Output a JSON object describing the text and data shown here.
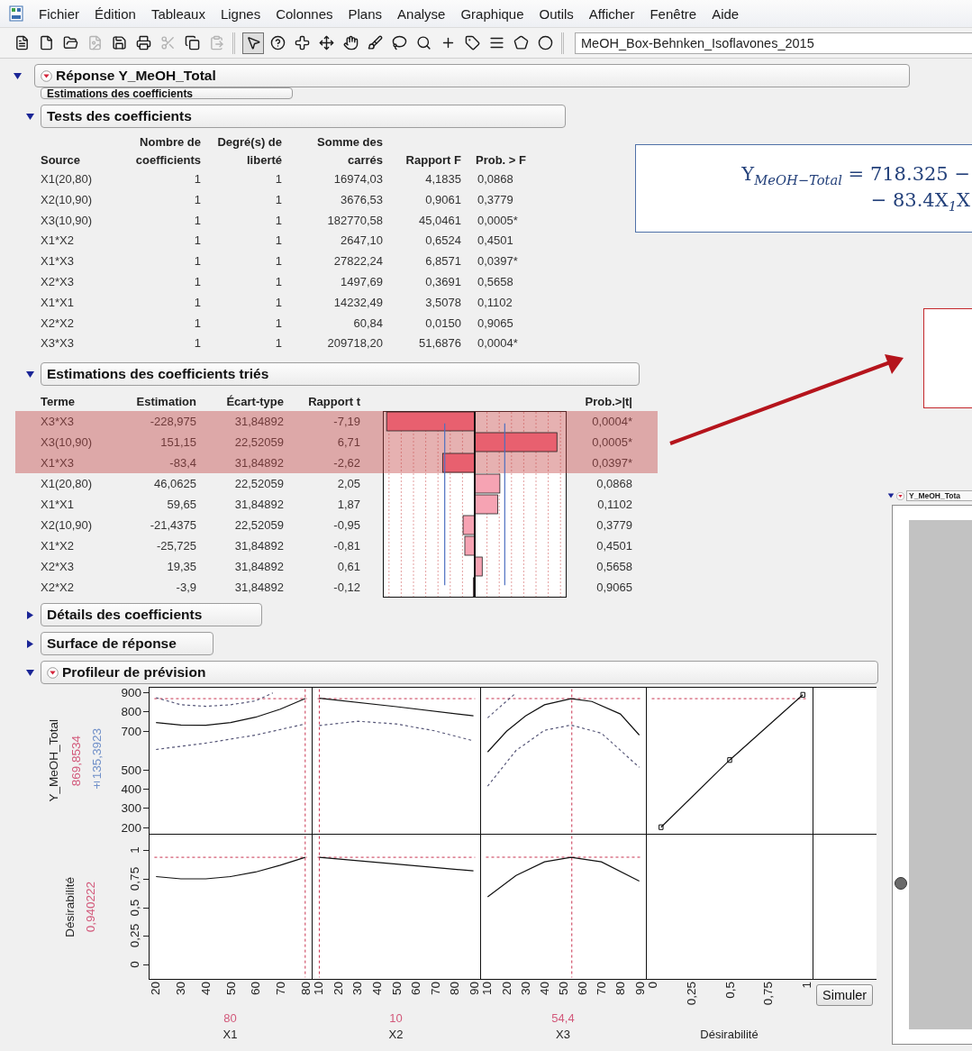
{
  "menu_bar": {
    "items": [
      "Fichier",
      "Édition",
      "Tableaux",
      "Lignes",
      "Colonnes",
      "Plans",
      "Analyse",
      "Graphique",
      "Outils",
      "Afficher",
      "Fenêtre",
      "Aide"
    ]
  },
  "toolbar": {
    "groups": [
      {
        "tools": [
          {
            "kind": "report",
            "selected": false,
            "disabled": false
          },
          {
            "kind": "new",
            "selected": false,
            "disabled": false
          },
          {
            "kind": "open",
            "selected": false,
            "disabled": false
          },
          {
            "kind": "image",
            "selected": false,
            "disabled": true
          },
          {
            "kind": "save",
            "selected": false,
            "disabled": false
          },
          {
            "kind": "print",
            "selected": false,
            "disabled": false
          },
          {
            "kind": "cut",
            "selected": false,
            "disabled": true
          },
          {
            "kind": "copy",
            "selected": false,
            "disabled": false
          },
          {
            "kind": "paste",
            "selected": false,
            "disabled": true
          }
        ]
      },
      {
        "tools": [
          {
            "kind": "arrow",
            "selected": true,
            "disabled": false
          },
          {
            "kind": "help",
            "selected": false,
            "disabled": false
          },
          {
            "kind": "crosshair",
            "selected": false,
            "disabled": false
          },
          {
            "kind": "move",
            "selected": false,
            "disabled": false
          },
          {
            "kind": "hand",
            "selected": false,
            "disabled": false
          },
          {
            "kind": "brush",
            "selected": false,
            "disabled": false
          },
          {
            "kind": "lasso",
            "selected": false,
            "disabled": false
          },
          {
            "kind": "zoom",
            "selected": false,
            "disabled": false
          },
          {
            "kind": "plus",
            "selected": false,
            "disabled": false
          },
          {
            "kind": "annotate",
            "selected": false,
            "disabled": false
          },
          {
            "kind": "lines",
            "selected": false,
            "disabled": false
          },
          {
            "kind": "polygon",
            "selected": false,
            "disabled": false
          },
          {
            "kind": "circle",
            "selected": false,
            "disabled": false
          }
        ]
      }
    ],
    "file_field": {
      "value": "MeOH_Box-Behnken_Isoflavones_2015"
    }
  },
  "report": {
    "title": "Réponse Y_MeOH_Total",
    "expanded": true,
    "menu_icon": true,
    "sections": [
      {
        "kind": "partial_header",
        "title": "Estimations des coefficients"
      },
      {
        "kind": "tests_table",
        "title": "Tests des coefficients",
        "expanded": true,
        "menu_icon": false,
        "columns": [
          "Source",
          "Nombre de coefficients",
          "Degré(s) de liberté",
          "Somme des carrés",
          "Rapport F",
          "Prob. > F"
        ],
        "rows": [
          [
            "X1(20,80)",
            "1",
            "1",
            "16974,03",
            "4,1835",
            "0,0868"
          ],
          [
            "X2(10,90)",
            "1",
            "1",
            "3676,53",
            "0,9061",
            "0,3779"
          ],
          [
            "X3(10,90)",
            "1",
            "1",
            "182770,58",
            "45,0461",
            "0,0005*"
          ],
          [
            "X1*X2",
            "1",
            "1",
            "2647,10",
            "0,6524",
            "0,4501"
          ],
          [
            "X1*X3",
            "1",
            "1",
            "27822,24",
            "6,8571",
            "0,0397*"
          ],
          [
            "X2*X3",
            "1",
            "1",
            "1497,69",
            "0,3691",
            "0,5658"
          ],
          [
            "X1*X1",
            "1",
            "1",
            "14232,49",
            "3,5078",
            "0,1102"
          ],
          [
            "X2*X2",
            "1",
            "1",
            "60,84",
            "0,0150",
            "0,9065"
          ],
          [
            "X3*X3",
            "1",
            "1",
            "209718,20",
            "51,6876",
            "0,0004*"
          ]
        ]
      },
      {
        "kind": "sorted_estimates",
        "title": "Estimations des coefficients triés",
        "expanded": true,
        "menu_icon": false,
        "columns": [
          "Terme",
          "Estimation",
          "Écart-type",
          "Rapport t",
          "Prob.>|t|"
        ],
        "rows": [
          {
            "cells": [
              "X3*X3",
              "-228,975",
              "31,84892",
              "-7,19",
              "0,0004*"
            ],
            "highlighted": true
          },
          {
            "cells": [
              "X3(10,90)",
              "151,15",
              "22,52059",
              "6,71",
              "0,0005*"
            ],
            "highlighted": true
          },
          {
            "cells": [
              "X1*X3",
              "-83,4",
              "31,84892",
              "-2,62",
              "0,0397*"
            ],
            "highlighted": true
          },
          {
            "cells": [
              "X1(20,80)",
              "46,0625",
              "22,52059",
              "2,05",
              "0,0868"
            ],
            "highlighted": false
          },
          {
            "cells": [
              "X1*X1",
              "59,65",
              "31,84892",
              "1,87",
              "0,1102"
            ],
            "highlighted": false
          },
          {
            "cells": [
              "X2(10,90)",
              "-21,4375",
              "22,52059",
              "-0,95",
              "0,3779"
            ],
            "highlighted": false
          },
          {
            "cells": [
              "X1*X2",
              "-25,725",
              "31,84892",
              "-0,81",
              "0,4501"
            ],
            "highlighted": false
          },
          {
            "cells": [
              "X2*X3",
              "19,35",
              "31,84892",
              "0,61",
              "0,5658"
            ],
            "highlighted": false
          },
          {
            "cells": [
              "X2*X2",
              "-3,9",
              "31,84892",
              "-0,12",
              "0,9065"
            ],
            "highlighted": false
          }
        ]
      },
      {
        "kind": "collapsed",
        "title": "Détails des coefficients",
        "expanded": false,
        "menu_icon": false
      },
      {
        "kind": "collapsed",
        "title": "Surface de réponse",
        "expanded": false,
        "menu_icon": false
      },
      {
        "kind": "profiler",
        "title": "Profileur de prévision",
        "expanded": true,
        "menu_icon": true,
        "responses": [
          {
            "name": "Y_MeOH_Total",
            "value": "869,8534",
            "interval": "±135,3923",
            "y_ticks": [
              "900",
              "800",
              "700",
              "500",
              "400",
              "300",
              "200"
            ]
          },
          {
            "name": "Désirabilité",
            "value": "0,940222",
            "y_ticks": [
              "1",
              "0,75",
              "0,5",
              "0,25",
              "0"
            ]
          }
        ],
        "factors": [
          {
            "name": "X1",
            "value": "80",
            "x_ticks": [
              "20",
              "30",
              "40",
              "50",
              "60",
              "70",
              "80"
            ]
          },
          {
            "name": "X2",
            "value": "10",
            "x_ticks": [
              "10",
              "20",
              "30",
              "40",
              "50",
              "60",
              "70",
              "80",
              "90"
            ]
          },
          {
            "name": "X3",
            "value": "54,4",
            "x_ticks": [
              "10",
              "20",
              "30",
              "40",
              "50",
              "60",
              "70",
              "80",
              "90"
            ]
          },
          {
            "name": "Désirabilité",
            "x_ticks": [
              "0",
              "0,25",
              "0,5",
              "0,75",
              "1"
            ]
          }
        ],
        "button": "Simuler"
      }
    ]
  },
  "side_window": {
    "title": "Y_MeOH_Tota",
    "expanded": true,
    "menu_icon": true
  },
  "annotations": [
    {
      "kind": "equation",
      "lines": [
        "Y$_{MeOH−Total}$ = 718.325 −",
        "− 83.4X$_{1}$X"
      ]
    },
    {
      "kind": "empty_box"
    },
    {
      "kind": "arrow"
    }
  ]
}
